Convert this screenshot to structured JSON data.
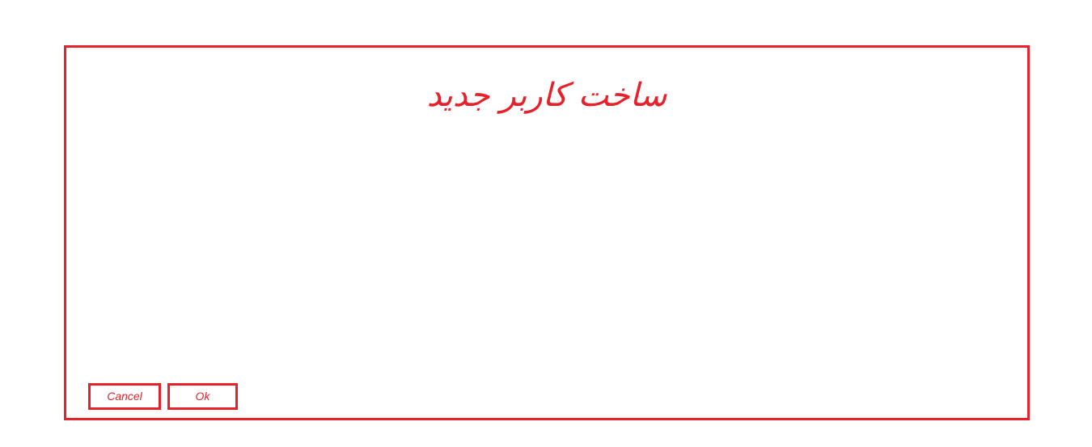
{
  "dialog": {
    "title": "ساخت کاربر جدید",
    "cancel_label": "Cancel",
    "ok_label": "Ok"
  },
  "colors": {
    "accent": "#e8202a",
    "background": "#ffffff"
  }
}
